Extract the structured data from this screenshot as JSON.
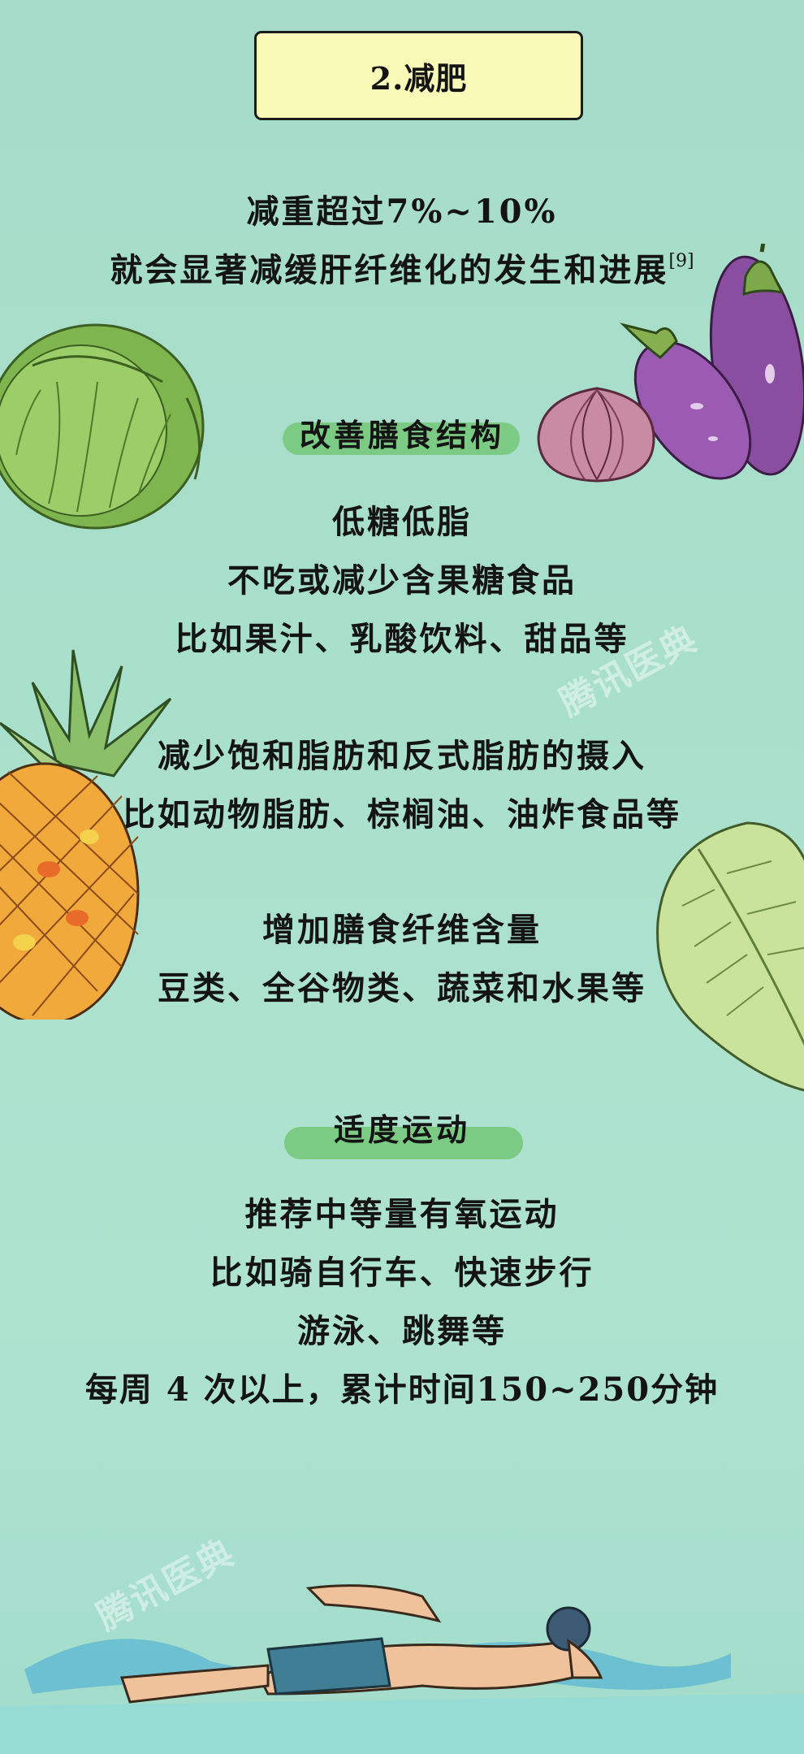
{
  "header": {
    "title": "2.减肥"
  },
  "intro": {
    "line1": "减重超过7%~10%",
    "line2": "就会显著减缓肝纤维化的发生和进展",
    "ref": "[9]"
  },
  "diet": {
    "heading": "改善膳食结构",
    "group1": [
      "低糖低脂",
      "不吃或减少含果糖食品",
      "比如果汁、乳酸饮料、甜品等"
    ],
    "group2": [
      "减少饱和脂肪和反式脂肪的摄入",
      "比如动物脂肪、棕榈油、油炸食品等"
    ],
    "group3": [
      "增加膳食纤维含量",
      "豆类、全谷物类、蔬菜和水果等"
    ]
  },
  "exercise": {
    "heading": "适度运动",
    "lines": [
      "推荐中等量有氧运动",
      "比如骑自行车、快速步行",
      "游泳、跳舞等",
      "每周 4 次以上，累计时间150~250分钟"
    ]
  },
  "watermark": {
    "text": "腾讯医典"
  },
  "illustrations": {
    "cabbage": "cabbage-illustration",
    "eggplant": "eggplant-illustration",
    "onion": "onion-illustration",
    "pineapple": "pineapple-illustration",
    "lettuce": "lettuce-illustration",
    "swimmer": "swimmer-illustration"
  },
  "colors": {
    "background": "#a9e0cc",
    "title_box": "#fafab8",
    "section_pill": "#7ccb84",
    "text": "#141414"
  }
}
